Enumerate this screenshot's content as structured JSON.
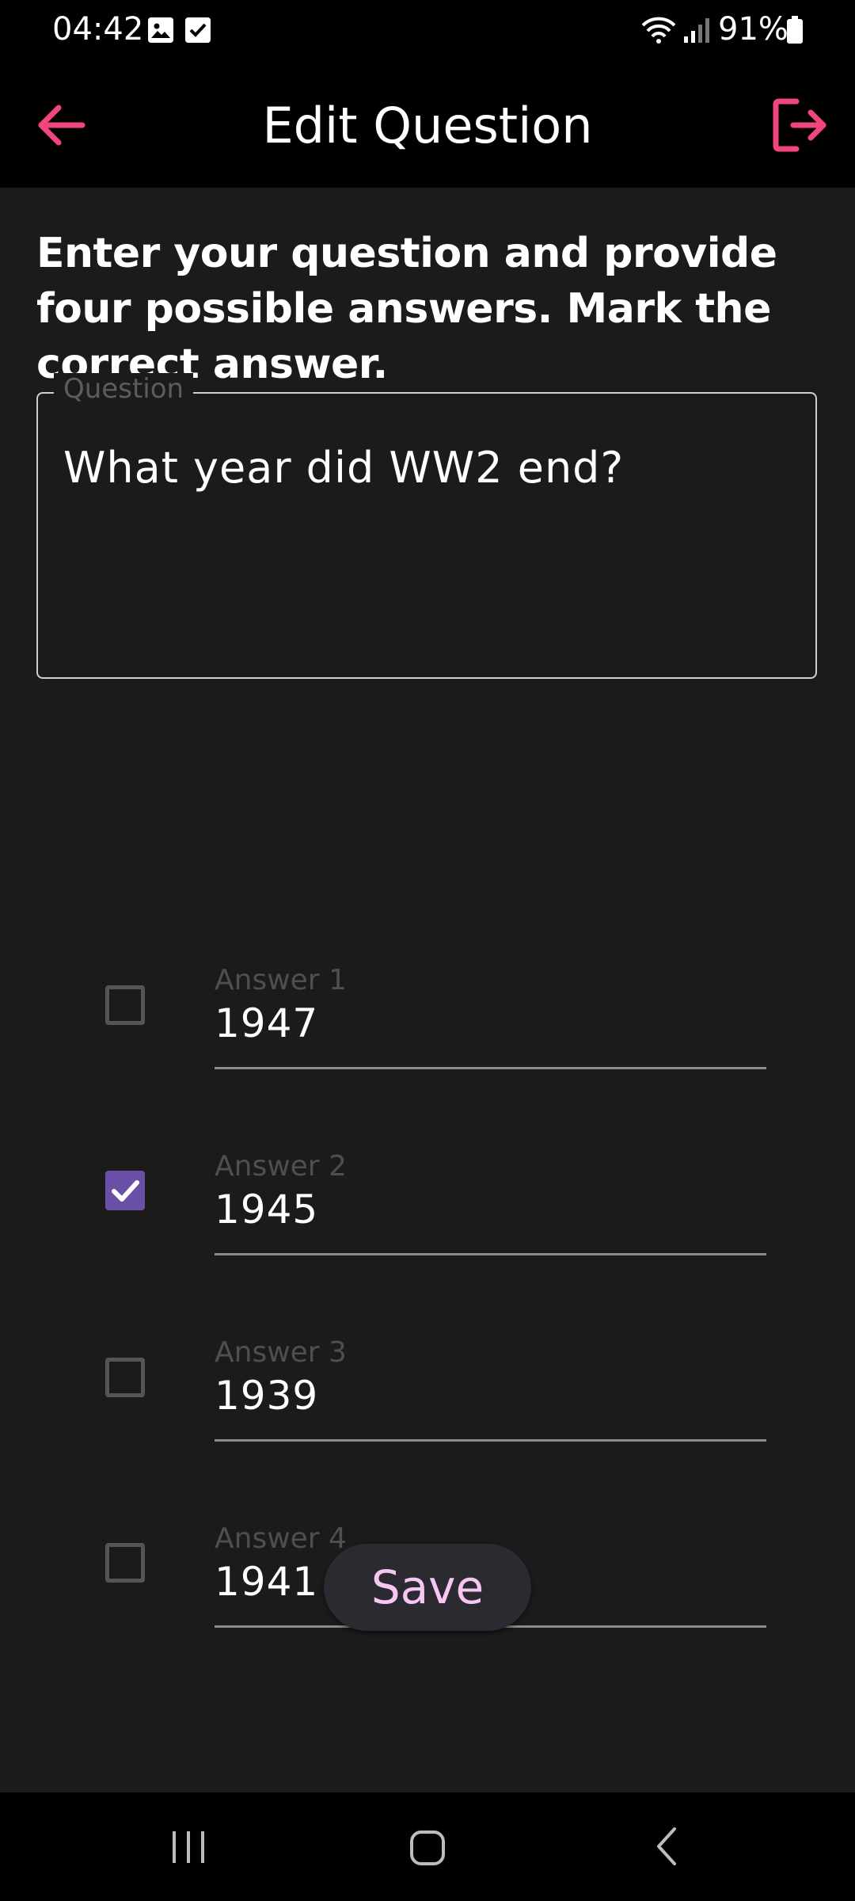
{
  "status_bar": {
    "time": "04:42",
    "battery": "91%",
    "icons": [
      "gallery-icon",
      "check-icon",
      "wifi-icon",
      "signal-icon",
      "battery-icon"
    ]
  },
  "header": {
    "title": "Edit Question",
    "back_icon": "arrow-left-icon",
    "logout_icon": "logout-icon"
  },
  "instructions": "Enter your question and provide four possible answers. Mark the correct answer.",
  "question": {
    "label": "Question",
    "value": "What year did WW2 end?"
  },
  "answers": [
    {
      "label": "Answer 1",
      "value": "1947",
      "correct": false
    },
    {
      "label": "Answer 2",
      "value": "1945",
      "correct": true
    },
    {
      "label": "Answer 3",
      "value": "1939",
      "correct": false
    },
    {
      "label": "Answer 4",
      "value": "1941",
      "correct": false
    }
  ],
  "save_label": "Save",
  "colors": {
    "accent": "#f0467c",
    "checkbox_checked": "#6a4fa6",
    "save_text": "#f6c7f0",
    "background": "#1b1b1b"
  },
  "nav_bar": {
    "icons": [
      "recent-apps-icon",
      "home-icon",
      "back-icon"
    ]
  }
}
